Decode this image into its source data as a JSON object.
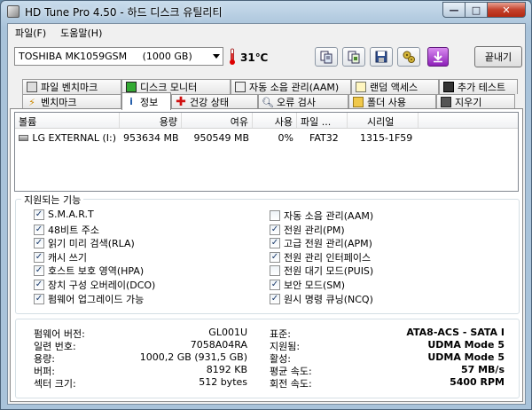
{
  "window": {
    "title": "HD Tune Pro 4.50 - 하드 디스크 유틸리티",
    "minimize": "—",
    "maximize": "□",
    "close": "✕"
  },
  "menu": [
    {
      "label": "파일(F)"
    },
    {
      "label": "도움말(H)"
    }
  ],
  "toolbar": {
    "drive": "TOSHIBA MK1059GSM     (1000 GB)",
    "temperature": "31℃",
    "exit_label": "끝내기",
    "icons": [
      "copy-info-icon",
      "copy-all-icon",
      "save-icon",
      "options-icon",
      "download-icon"
    ]
  },
  "tabs_row1": [
    {
      "label": "파일 벤치마크",
      "icon": "file-benchmark-icon"
    },
    {
      "label": "디스크 모니터",
      "icon": "disk-monitor-icon"
    },
    {
      "label": "자동 소음 관리(AAM)",
      "icon": "aam-icon"
    },
    {
      "label": "랜덤 액세스",
      "icon": "random-access-icon"
    },
    {
      "label": "추가 테스트",
      "icon": "extra-tests-icon"
    }
  ],
  "tabs_row2": [
    {
      "label": "벤치마크",
      "icon": "benchmark-icon"
    },
    {
      "label": "정보",
      "icon": "info-icon",
      "active": true
    },
    {
      "label": "건강 상태",
      "icon": "health-icon"
    },
    {
      "label": "오류 검사",
      "icon": "error-scan-icon"
    },
    {
      "label": "폴더 사용",
      "icon": "folder-usage-icon"
    },
    {
      "label": "지우기",
      "icon": "erase-icon"
    }
  ],
  "volumes": {
    "headers": [
      "볼륨",
      "용량",
      "여유",
      "사용",
      "파일 ...",
      "시리얼"
    ],
    "rows": [
      {
        "name": "LG EXTERNAL (I:)",
        "capacity": "953634 MB",
        "free": "950549 MB",
        "used": "0%",
        "fs": "FAT32",
        "serial": "1315-1F59"
      }
    ]
  },
  "features": {
    "title": "지원되는 기능",
    "left": [
      {
        "label": "S.M.A.R.T",
        "checked": true
      },
      {
        "label": "48비트 주소",
        "checked": true
      },
      {
        "label": "읽기 미리 검색(RLA)",
        "checked": true
      },
      {
        "label": "캐시 쓰기",
        "checked": true
      },
      {
        "label": "호스트 보호 영역(HPA)",
        "checked": true
      },
      {
        "label": "장치 구성 오버레이(DCO)",
        "checked": true
      },
      {
        "label": "펌웨어 업그레이드 가능",
        "checked": true
      }
    ],
    "right": [
      {
        "label": "자동 소음 관리(AAM)",
        "checked": false
      },
      {
        "label": "전원 관리(PM)",
        "checked": true
      },
      {
        "label": "고급 전원 관리(APM)",
        "checked": true
      },
      {
        "label": "전원 관리 인터페이스",
        "checked": true
      },
      {
        "label": "전원 대기 모드(PUIS)",
        "checked": false
      },
      {
        "label": "보안 모드(SM)",
        "checked": true
      },
      {
        "label": "원시 명령 큐닝(NCQ)",
        "checked": true
      }
    ]
  },
  "details": {
    "left": [
      {
        "label": "펌웨어 버전:",
        "value": "GL001U"
      },
      {
        "label": "일련 번호:",
        "value": "7058A04RA"
      },
      {
        "label": "용량:",
        "value": "1000,2 GB (931,5 GB)"
      },
      {
        "label": "버퍼:",
        "value": "8192 KB"
      },
      {
        "label": "섹터 크기:",
        "value": "512 bytes"
      }
    ],
    "right": [
      {
        "label": "표준:",
        "value": "ATA8-ACS - SATA I"
      },
      {
        "label": "지원됨:",
        "value": "UDMA Mode 5"
      },
      {
        "label": "활성:",
        "value": "UDMA Mode 5"
      },
      {
        "label": "평균 속도:",
        "value": "57 MB/s"
      },
      {
        "label": "회전 속도:",
        "value": "5400 RPM"
      }
    ]
  }
}
